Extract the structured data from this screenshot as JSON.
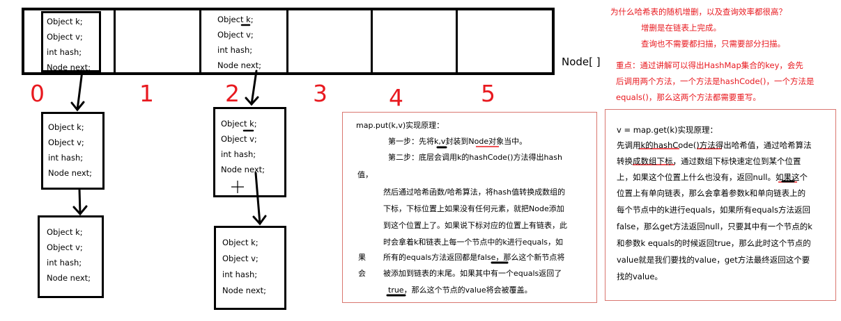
{
  "node_fields": [
    "Object k;",
    "Object v;",
    "int hash;",
    "Node next;"
  ],
  "array_label": "Node[ ]",
  "indices": [
    "0",
    "1",
    "2",
    "3",
    "4",
    "5"
  ],
  "notes": {
    "question": "为什么哈希表的随机增删，以及查询效率都很高？",
    "answer1": "增删是在链表上完成。",
    "answer2": "查询也不需要都扫描，只需要部分扫描。",
    "key1": "重点：通过讲解可以得出HashMap集合的key，会先",
    "key2": "后调用两个方法，一个方法是hashCode()，一个方法是",
    "key3": "equals()，那么这两个方法都需要重写。"
  },
  "put_panel": {
    "title": "map.put(k,v)实现原理：",
    "lines": [
      "第一步：先将k,v封装到Node对象当中。",
      "第二步：底层会调用k的hashCode()方法得出hash",
      "值，",
      "然后通过哈希函数/哈希算法，将hash值转换成数组的",
      "下标，下标位置上如果没有任何元素，就把Node添加",
      "到这个位置上了。如果说下标对应的位置上有链表，此",
      "时会拿着k和链表上每一个节点中的k进行equals，如",
      "所有的equals方法返回都是false，那么这个新节点将",
      "被添加到链表的末尾。如果其中有一个equals返回了",
      "true，那么这个节点的value将会被覆盖。"
    ],
    "side1": "果",
    "side2": "会"
  },
  "get_panel": {
    "title": "v = map.get(k)实现原理：",
    "lines": [
      "先调用k的hashCode()方法得出哈希值，通过哈希算法",
      "转换成数组下标，通过数组下标快速定位到某个位置",
      "上，如果这个位置上什么也没有，返回null。如果这个",
      "位置上有单向链表，那么会拿着参数k和单向链表上的",
      "每个节点中的k进行equals，如果所有equals方法返回",
      "false，那么get方法返回null，只要其中有一个节点的k",
      "和参数k equals的时候返回true，那么此时这个节点的",
      "value就是我们要找的value，get方法最终返回这个要",
      "找的value。"
    ]
  }
}
